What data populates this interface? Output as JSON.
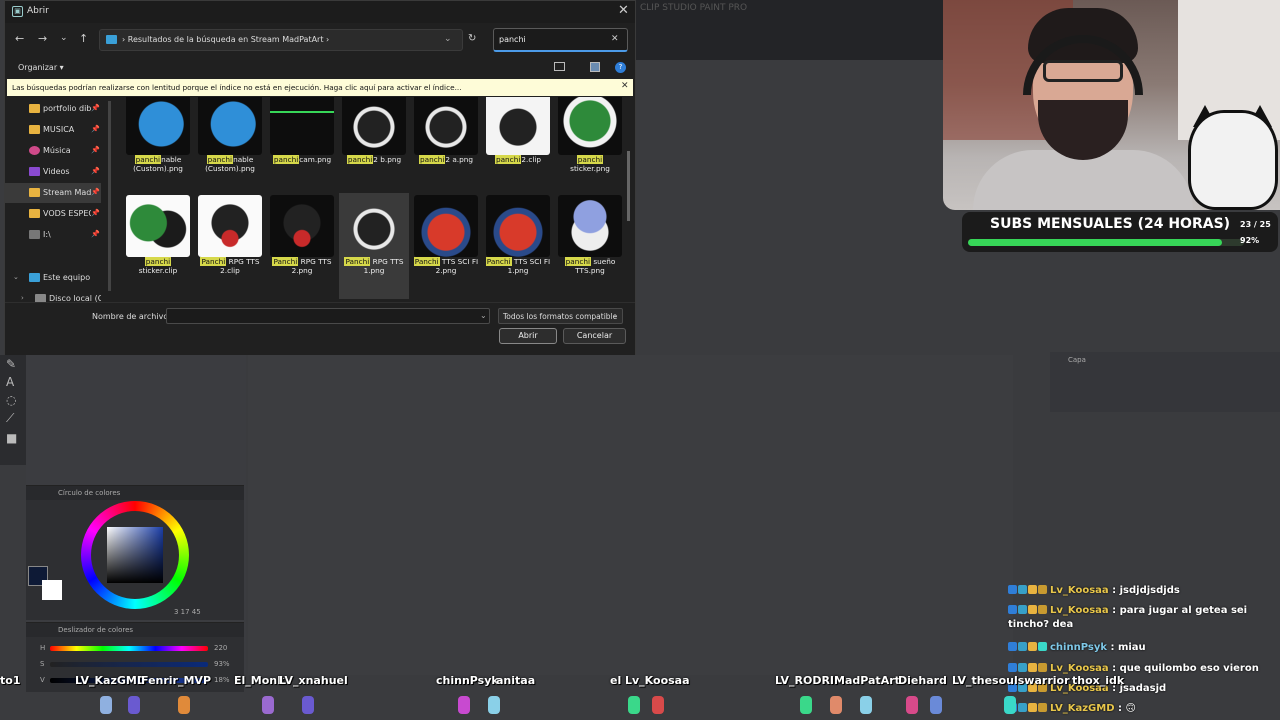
{
  "dialog": {
    "title": "Abrir",
    "address": "›  Resultados de la búsqueda en Stream MadPatArt  ›",
    "search_value": "panchi",
    "organize_label": "Organizar ▾",
    "info_bar": "Las búsquedas podrían realizarse con lentitud porque el índice no está en ejecución. Haga clic aquí para activar el índice...",
    "sidebar": [
      {
        "label": "portfolio dib",
        "color": "#e8b340",
        "pinned": true
      },
      {
        "label": "MUSICA",
        "color": "#e8b340",
        "pinned": true
      },
      {
        "label": "Música",
        "color": "#d04a8a",
        "pinned": true
      },
      {
        "label": "Videos",
        "color": "#8a4ad0",
        "pinned": true
      },
      {
        "label": "Stream MadP",
        "color": "#e8b340",
        "pinned": true
      },
      {
        "label": "VODS ESPECI",
        "color": "#e8b340",
        "pinned": true
      },
      {
        "label": "I:\\",
        "color": "#777",
        "pinned": true
      },
      {
        "label": "Este equipo",
        "color": "#3aa0d8",
        "pinned": false
      },
      {
        "label": "Disco local (C:",
        "color": "#888",
        "pinned": false
      }
    ],
    "files_row1": [
      {
        "hl": "panchi",
        "rest": "nable (Custom).png"
      },
      {
        "hl": "panchi",
        "rest": "nable (Custom).png"
      },
      {
        "hl": "panchi",
        "rest": "cam.png"
      },
      {
        "hl": "panchi",
        "rest": "2 b.png"
      },
      {
        "hl": "panchi",
        "rest": "2 a.png"
      },
      {
        "hl": "panchi",
        "rest": "2.clip"
      },
      {
        "hl": "panchi",
        "rest": " sticker.png"
      }
    ],
    "files_row2": [
      {
        "hl": "panchi",
        "rest": " sticker.clip"
      },
      {
        "hl": "Panchi",
        "rest": " RPG TTS 2.clip"
      },
      {
        "hl": "Panchi",
        "rest": " RPG TTS 2.png"
      },
      {
        "hl": "Panchi",
        "rest": " RPG TTS 1.png"
      },
      {
        "hl": "Panchi",
        "rest": " TTS SCI FI 2.png"
      },
      {
        "hl": "Panchi",
        "rest": " TTS SCI FI 1.png"
      },
      {
        "hl": "panchi",
        "rest": " sueño TTS.png"
      }
    ],
    "filename_label": "Nombre de archivo:",
    "filename_value": "",
    "format": "Todos los formatos compatible",
    "open_label": "Abrir",
    "cancel_label": "Cancelar"
  },
  "app": {
    "title": "CLIP STUDIO PAINT PRO",
    "color_circle_tab": "Círculo de colores",
    "slider_tab": "Deslizador de colores",
    "rgb": "3  17  45",
    "sliders": [
      {
        "label": "H",
        "value": "220"
      },
      {
        "label": "S",
        "value": "93%"
      },
      {
        "label": "V",
        "value": "18%"
      }
    ],
    "layer_tab": "Capa"
  },
  "overlay": {
    "subs_title": "SUBS MENSUALES (24 HORAS)",
    "subs_count": "23 / 25",
    "subs_pct": "92%",
    "subs_progress": 0.92
  },
  "chat": [
    {
      "user": "Lv_Koosaa",
      "msg": " : jsdjdjsdjds",
      "blue": false
    },
    {
      "user": "Lv_Koosaa",
      "msg": " : para jugar al getea sei tincho? dea",
      "blue": false
    },
    {
      "user": "chinnPsyk",
      "msg": " : miau",
      "blue": true
    },
    {
      "user": "Lv_Koosaa",
      "msg": " : que quilombo eso vieron",
      "blue": false
    },
    {
      "user": "Lv_Koosaa",
      "msg": " : jsadasjd",
      "blue": false
    },
    {
      "user": "LV_KazGMD",
      "msg": " : 🙃",
      "blue": false
    }
  ],
  "viewers": [
    {
      "name": "to1"
    },
    {
      "name": "LV_KazGMD"
    },
    {
      "name": "Fenrir_MVP"
    },
    {
      "name": "El_Monk"
    },
    {
      "name": "LV_xnahuel"
    },
    {
      "name": "chinnPsyk"
    },
    {
      "name": "anitaa"
    },
    {
      "name": "el"
    },
    {
      "name": "Lv_Koosaa"
    },
    {
      "name": "LV_RODRII"
    },
    {
      "name": "MadPatArt"
    },
    {
      "name": "Diehard"
    },
    {
      "name": "LV_thesoulswarrior"
    },
    {
      "name": "thox_idk"
    }
  ]
}
